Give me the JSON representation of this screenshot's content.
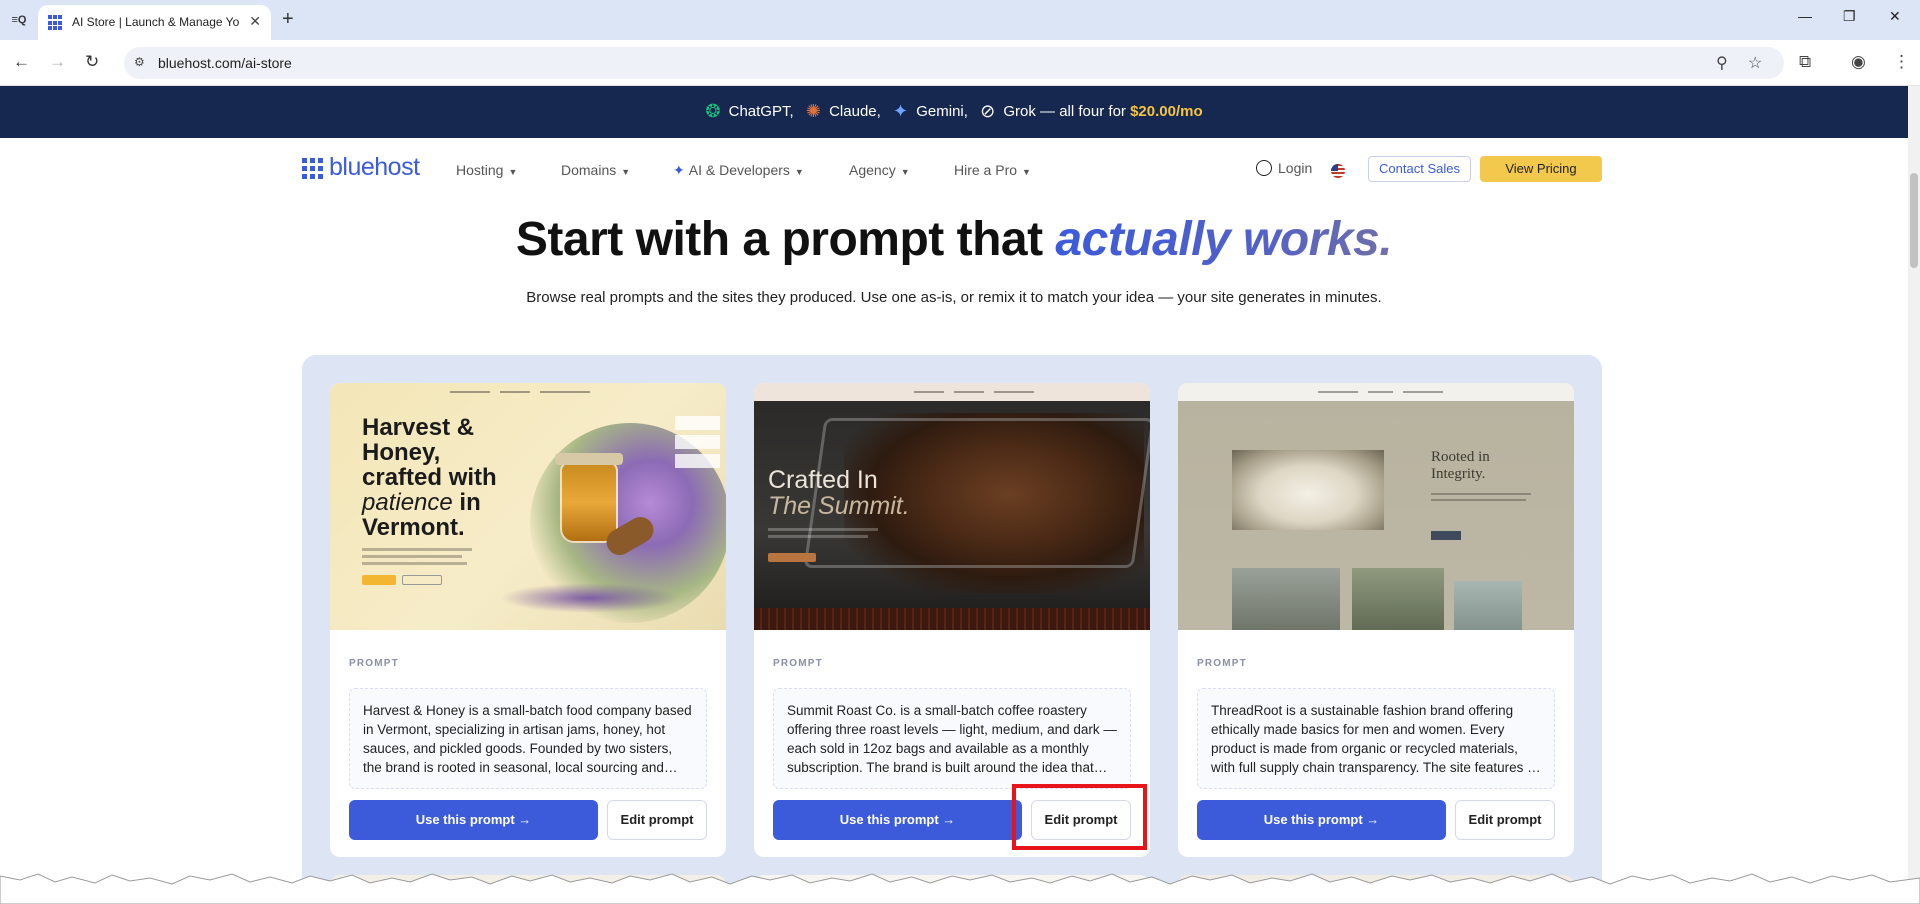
{
  "browser": {
    "tab_title": "AI Store | Launch & Manage Yo",
    "url": "bluehost.com/ai-store"
  },
  "promo": {
    "items": [
      "ChatGPT,",
      "Claude,",
      "Gemini,",
      "Grok"
    ],
    "suffix": "— all four for",
    "price": "$20.00/mo",
    "colors": {
      "bar": "#16284f",
      "price": "#f5c542"
    }
  },
  "nav": {
    "logo": "bluehost",
    "items": [
      {
        "label": "Hosting"
      },
      {
        "label": "Domains"
      },
      {
        "label": "AI & Developers"
      },
      {
        "label": "Agency"
      },
      {
        "label": "Hire a Pro"
      }
    ],
    "login": "Login",
    "contact": "Contact Sales",
    "pricing": "View Pricing"
  },
  "hero": {
    "title_plain": "Start with a prompt that",
    "title_em": "actually works.",
    "subtitle": "Browse real prompts and the sites they produced. Use one as-is, or remix it to match your idea — your site generates in minutes."
  },
  "cards": [
    {
      "thumb": {
        "headline_a": "Harvest &",
        "headline_b": "Honey,",
        "headline_c": "crafted with",
        "headline_d_em": "patience",
        "headline_d": " in",
        "headline_e": "Vermont."
      },
      "label": "PROMPT",
      "prompt": "Harvest & Honey is a small-batch food company based in Vermont, specializing in artisan jams, honey, hot sauces, and pickled goods. Founded by two sisters, the brand is rooted in seasonal, local sourcing and traditional recipes.",
      "use_label": "Use this prompt →",
      "edit_label": "Edit prompt"
    },
    {
      "thumb": {
        "headline_a": "Crafted In",
        "headline_b": "The Summit."
      },
      "label": "PROMPT",
      "prompt": "Summit Roast Co. is a small-batch coffee roastery offering three roast levels — light, medium, and dark — each sold in 12oz bags and available as a monthly subscription. The brand is built around the idea that great coffee starts at the source.",
      "use_label": "Use this prompt →",
      "edit_label": "Edit prompt"
    },
    {
      "thumb": {
        "headline_a": "Rooted in",
        "headline_b": "Integrity."
      },
      "label": "PROMPT",
      "prompt": "ThreadRoot is a sustainable fashion brand offering ethically made basics for men and women. Every product is made from organic or recycled materials, with full supply chain transparency. The site features a clean storefront and brand story.",
      "use_label": "Use this prompt →",
      "edit_label": "Edit prompt"
    }
  ],
  "colors": {
    "accent": "#3b5bdb",
    "highlight": "#e8141b",
    "pricing": "#f2c94c"
  }
}
